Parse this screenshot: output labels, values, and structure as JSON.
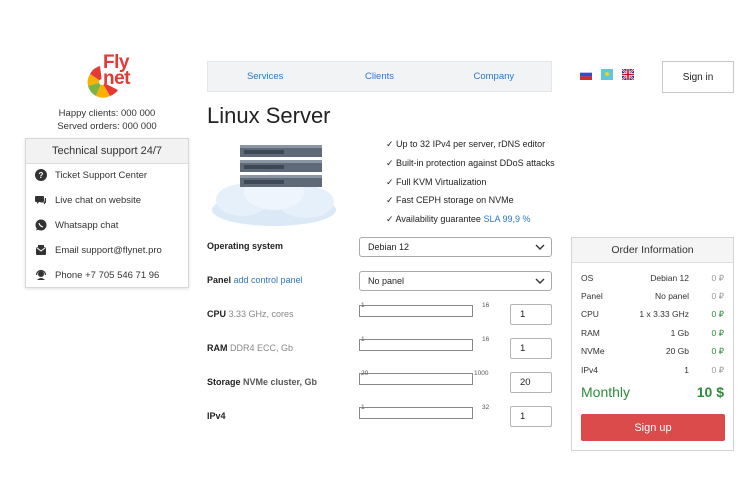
{
  "logo": {
    "line1": "Fly",
    "line2": "net"
  },
  "stats": {
    "happy_clients": "Happy clients: 000 000",
    "served_orders": "Served orders: 000 000"
  },
  "support": {
    "title": "Technical support 24/7",
    "items": [
      {
        "label": "Ticket Support Center",
        "icon": "help-icon"
      },
      {
        "label": "Live chat on website",
        "icon": "chat-icon"
      },
      {
        "label": "Whatsapp chat",
        "icon": "whatsapp-icon"
      },
      {
        "label": "Email support@flynet.pro",
        "icon": "email-icon"
      },
      {
        "label": "Phone +7 705 546 71 96",
        "icon": "headset-icon"
      }
    ]
  },
  "nav": {
    "items": [
      "Services",
      "Clients",
      "Company"
    ]
  },
  "flags": [
    "ru-flag-icon",
    "kz-flag-icon",
    "uk-flag-icon"
  ],
  "signin_label": "Sign in",
  "page_title": "Linux Server",
  "features": [
    "✓ Up to 32 IPv4 per server, rDNS editor",
    "✓ Built-in protection against DDoS attacks",
    "✓ Full KVM Virtualization",
    "✓ Fast CEPH storage on NVMe",
    "✓ Availability guarantee "
  ],
  "sla_link": "SLA 99,9 %",
  "config": {
    "os": {
      "label": "Operating system",
      "value": "Debian 12"
    },
    "panel": {
      "label": "Panel",
      "link": "add control panel",
      "value": "No panel"
    },
    "cpu": {
      "label": "CPU",
      "sub": "3.33 GHz, cores",
      "min": "1",
      "max": "16",
      "value": "1"
    },
    "ram": {
      "label": "RAM",
      "sub": "DDR4 ECC, Gb",
      "min": "1",
      "max": "16",
      "value": "1"
    },
    "storage": {
      "label": "Storage",
      "sub": "NVMe cluster, Gb",
      "min": "20",
      "max": "1000",
      "value": "20"
    },
    "ipv4": {
      "label": "IPv4",
      "min": "1",
      "max": "32",
      "value": "1"
    }
  },
  "order": {
    "title": "Order Information",
    "rows": [
      {
        "k": "OS",
        "v": "Debian 12",
        "p": "0 ₽",
        "green": false
      },
      {
        "k": "Panel",
        "v": "No panel",
        "p": "0 ₽",
        "green": false
      },
      {
        "k": "CPU",
        "v": "1 x 3.33 GHz",
        "p": "0 ₽",
        "green": true
      },
      {
        "k": "RAM",
        "v": "1 Gb",
        "p": "0 ₽",
        "green": true
      },
      {
        "k": "NVMe",
        "v": "20 Gb",
        "p": "0 ₽",
        "green": true
      },
      {
        "k": "IPv4",
        "v": "1",
        "p": "0 ₽",
        "green": false
      }
    ],
    "monthly_label": "Monthly",
    "total": "10 $",
    "signup_label": "Sign up"
  },
  "colors": {
    "accent": "#2f78c4",
    "green": "#2e8b3a",
    "signup": "#dc4b4b",
    "logo": "#e53935"
  }
}
